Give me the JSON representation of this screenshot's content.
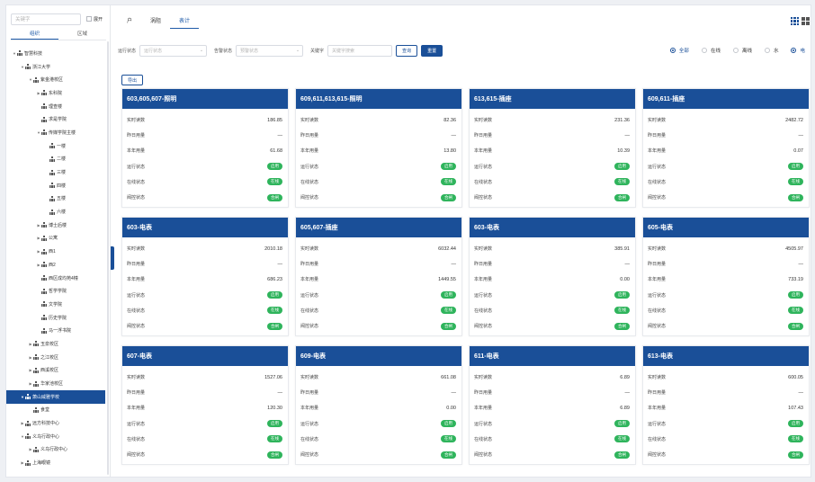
{
  "sidebar": {
    "search_placeholder": "关键字",
    "expand_label": "展开",
    "tabs": [
      "组织",
      "区域"
    ],
    "tree": [
      {
        "label": "智慧科技",
        "level": 0,
        "caret": "▼"
      },
      {
        "label": "浙江大学",
        "level": 1,
        "caret": "▼"
      },
      {
        "label": "紫金港校区",
        "level": 2,
        "caret": "▼"
      },
      {
        "label": "东科院",
        "level": 3,
        "caret": "▶"
      },
      {
        "label": "理查楼",
        "level": 3,
        "caret": ""
      },
      {
        "label": "求是学院",
        "level": 3,
        "caret": ""
      },
      {
        "label": "传媒学院主楼",
        "level": 3,
        "caret": "▼"
      },
      {
        "label": "一楼",
        "level": 4,
        "caret": ""
      },
      {
        "label": "二楼",
        "level": 4,
        "caret": ""
      },
      {
        "label": "三楼",
        "level": 4,
        "caret": ""
      },
      {
        "label": "四楼",
        "level": 4,
        "caret": ""
      },
      {
        "label": "五楼",
        "level": 4,
        "caret": ""
      },
      {
        "label": "六楼",
        "level": 4,
        "caret": ""
      },
      {
        "label": "博士后楼",
        "level": 3,
        "caret": "▶"
      },
      {
        "label": "公寓",
        "level": 3,
        "caret": "▶"
      },
      {
        "label": "西1",
        "level": 3,
        "caret": "▶"
      },
      {
        "label": "西2",
        "level": 3,
        "caret": "▶"
      },
      {
        "label": "西区成均苑4幢",
        "level": 3,
        "caret": ""
      },
      {
        "label": "哲学学院",
        "level": 3,
        "caret": ""
      },
      {
        "label": "文学院",
        "level": 3,
        "caret": ""
      },
      {
        "label": "历史学院",
        "level": 3,
        "caret": ""
      },
      {
        "label": "马一浮书院",
        "level": 3,
        "caret": ""
      },
      {
        "label": "玉泉校区",
        "level": 2,
        "caret": "▶"
      },
      {
        "label": "之江校区",
        "level": 2,
        "caret": "▶"
      },
      {
        "label": "西溪校区",
        "level": 2,
        "caret": "▶"
      },
      {
        "label": "华家池校区",
        "level": 2,
        "caret": "▶"
      },
      {
        "label": "萧山威雅学校",
        "level": 1,
        "caret": "▼",
        "selected": true
      },
      {
        "label": "食堂",
        "level": 2,
        "caret": ""
      },
      {
        "label": "远方科技中心",
        "level": 1,
        "caret": "▶"
      },
      {
        "label": "义乌行政中心",
        "level": 1,
        "caret": "▼"
      },
      {
        "label": "义乌行政中心",
        "level": 2,
        "caret": "▶"
      },
      {
        "label": "上海眼镜",
        "level": 1,
        "caret": "▶"
      }
    ]
  },
  "main": {
    "tabs": [
      "户",
      "涡阻",
      "表计"
    ],
    "active_tab": 2,
    "filters": {
      "run_label": "运行状态",
      "run_placeholder": "运行状态",
      "alarm_label": "告警状态",
      "alarm_placeholder": "预警状态",
      "keyword_label": "关键字",
      "keyword_placeholder": "关键字搜索",
      "query_btn": "查询",
      "reset_btn": "重置"
    },
    "radios": [
      {
        "label": "全部",
        "on": true
      },
      {
        "label": "在线",
        "on": false
      },
      {
        "label": "离线",
        "on": false
      },
      {
        "label": "水",
        "on": false
      },
      {
        "label": "电",
        "on": true
      }
    ],
    "export_btn": "导出",
    "row_labels": [
      "实时读数",
      "昨日用量",
      "本年用量",
      "运行状态",
      "在线状态",
      "阀控状态"
    ],
    "cards": [
      {
        "title": "603,605,607-照明",
        "reading": "186.85",
        "yesterday": "—",
        "year": "61.68",
        "run": "启用",
        "online": "在线",
        "valve": "合闸"
      },
      {
        "title": "609,611,613,615-照明",
        "reading": "82.36",
        "yesterday": "—",
        "year": "13.80",
        "run": "启用",
        "online": "在线",
        "valve": "合闸"
      },
      {
        "title": "613,615-插座",
        "reading": "231.36",
        "yesterday": "—",
        "year": "10.39",
        "run": "启用",
        "online": "在线",
        "valve": "合闸"
      },
      {
        "title": "609,611-插座",
        "reading": "2482.72",
        "yesterday": "—",
        "year": "0.07",
        "run": "启用",
        "online": "在线",
        "valve": "合闸"
      },
      {
        "title": "603-电表",
        "reading": "2010.18",
        "yesterday": "—",
        "year": "686.23",
        "run": "启用",
        "online": "在线",
        "valve": "合闸"
      },
      {
        "title": "605,607-插座",
        "reading": "6032.44",
        "yesterday": "—",
        "year": "1449.55",
        "run": "启用",
        "online": "在线",
        "valve": "合闸"
      },
      {
        "title": "603-电表",
        "reading": "385.91",
        "yesterday": "—",
        "year": "0.00",
        "run": "启用",
        "online": "在线",
        "valve": "合闸"
      },
      {
        "title": "605-电表",
        "reading": "4505.97",
        "yesterday": "—",
        "year": "733.19",
        "run": "启用",
        "online": "在线",
        "valve": "合闸"
      },
      {
        "title": "607-电表",
        "reading": "1527.06",
        "yesterday": "—",
        "year": "120.30",
        "run": "启用",
        "online": "在线",
        "valve": "合闸"
      },
      {
        "title": "609-电表",
        "reading": "661.08",
        "yesterday": "—",
        "year": "0.00",
        "run": "启用",
        "online": "在线",
        "valve": "合闸"
      },
      {
        "title": "611-电表",
        "reading": "6.89",
        "yesterday": "—",
        "year": "6.89",
        "run": "启用",
        "online": "在线",
        "valve": "合闸"
      },
      {
        "title": "613-电表",
        "reading": "600.05",
        "yesterday": "—",
        "year": "107.43",
        "run": "启用",
        "online": "在线",
        "valve": "合闸"
      }
    ]
  },
  "colors": {
    "brand": "#1a4f98",
    "badge": "#2fb45c"
  }
}
